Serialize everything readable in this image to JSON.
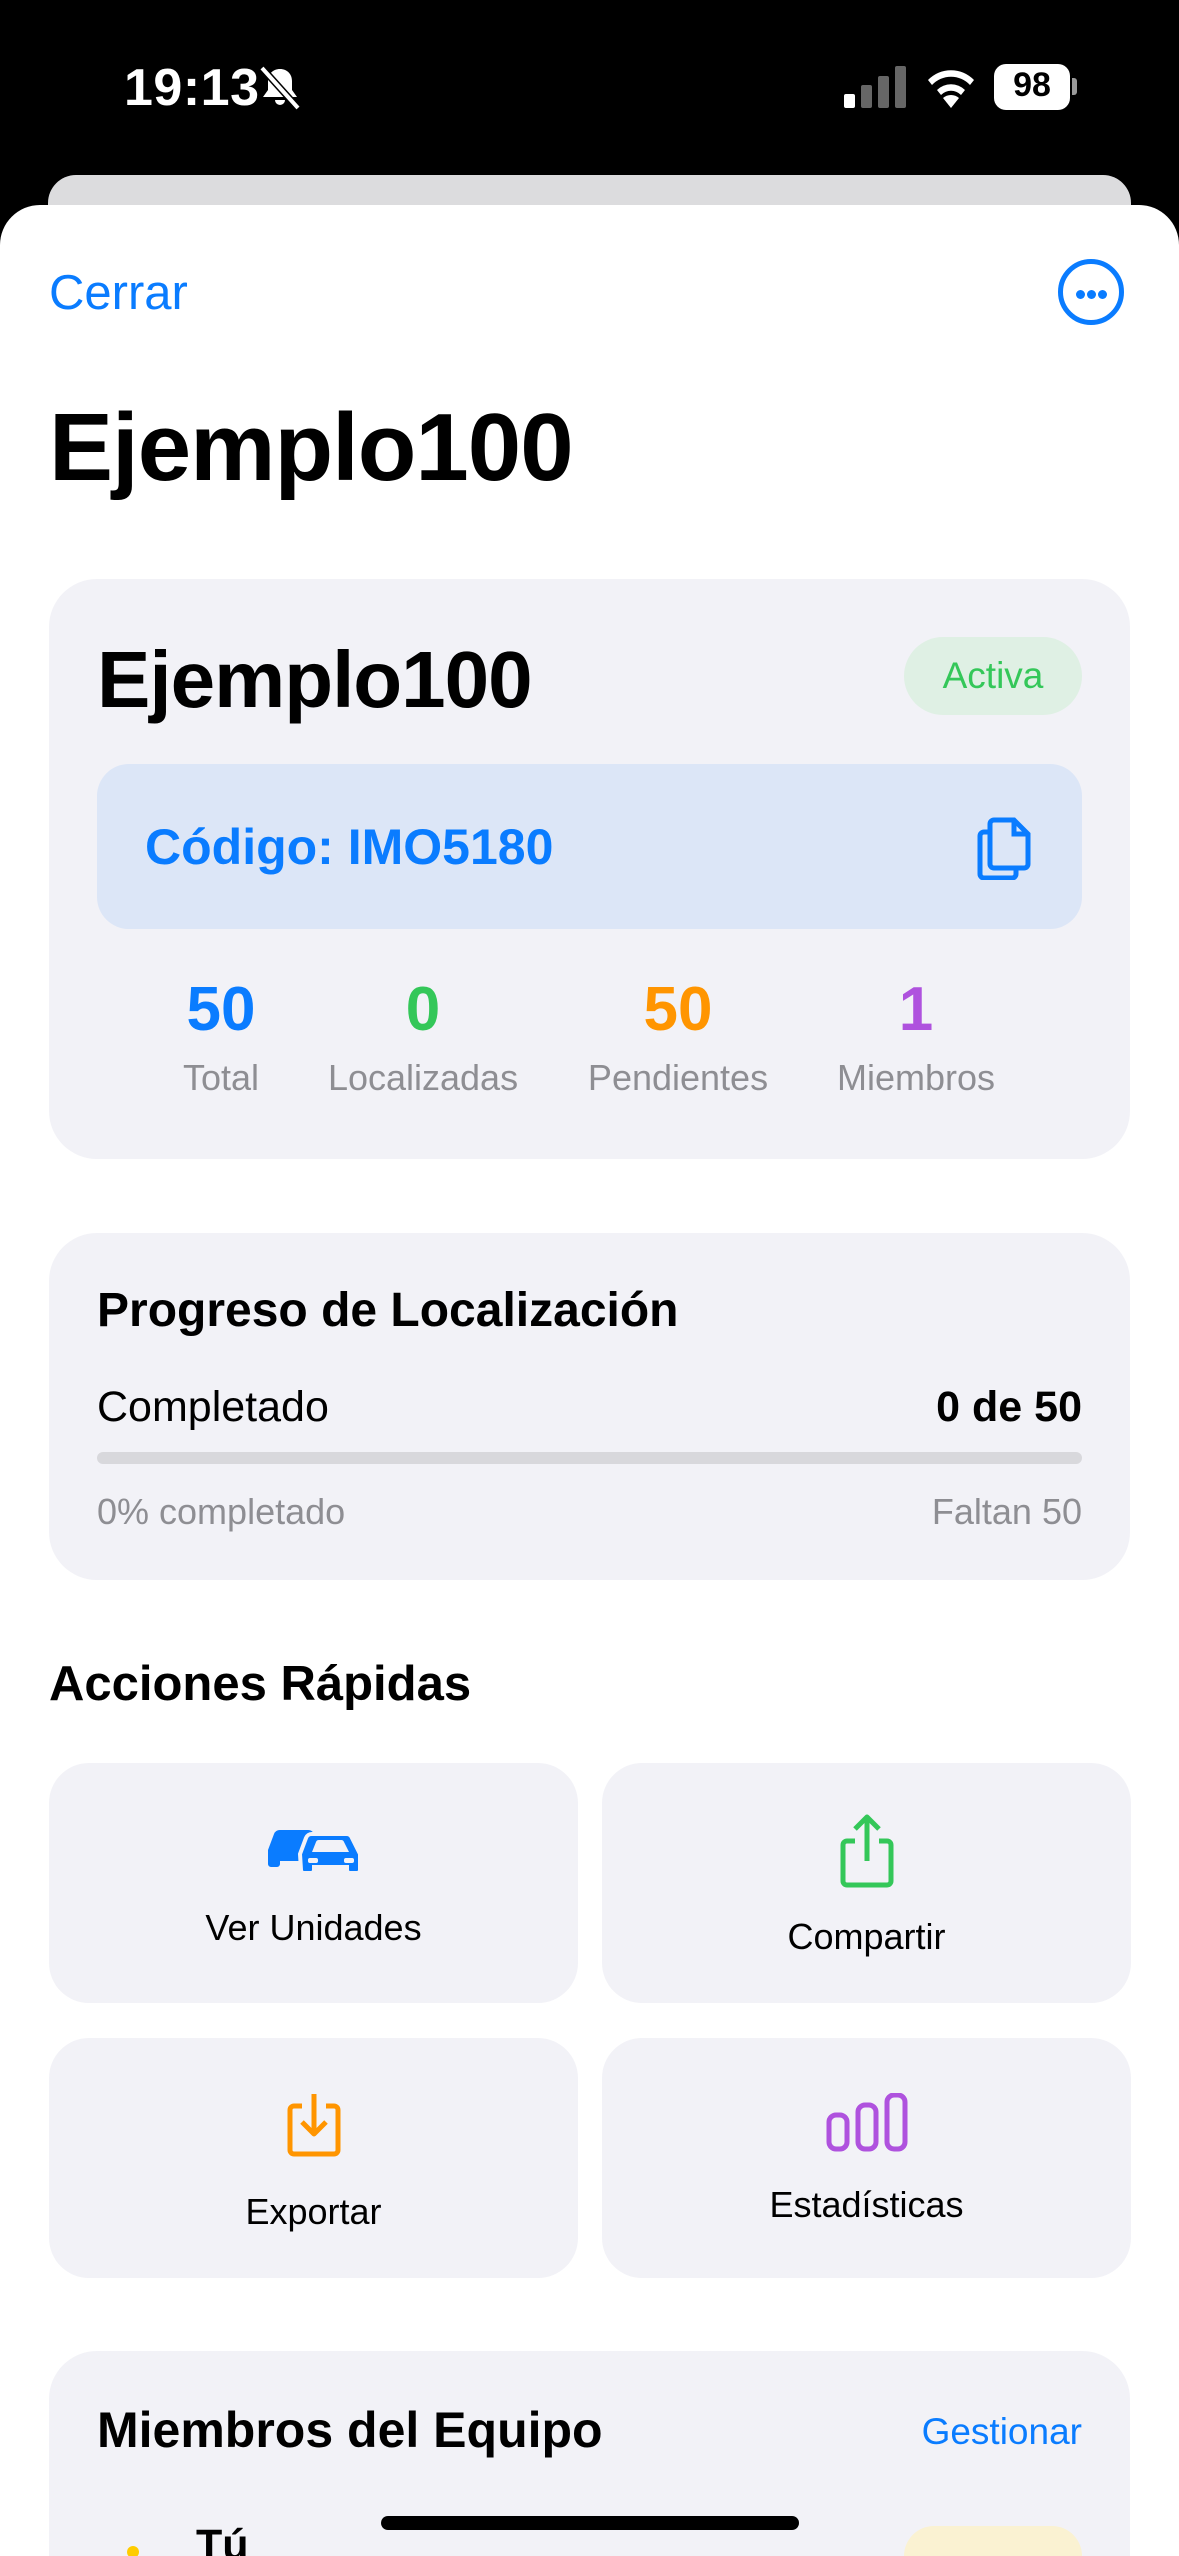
{
  "status_bar": {
    "time": "19:13",
    "battery": "98",
    "icons": [
      "bell-slash-icon",
      "cellular-signal-icon",
      "wifi-icon",
      "battery-icon"
    ]
  },
  "nav": {
    "close_label": "Cerrar",
    "more_icon": "ellipsis-circle-icon",
    "title": "Ejemplo100"
  },
  "summary": {
    "name": "Ejemplo100",
    "status": "Activa",
    "code_label": "Código: IMO5180",
    "copy_icon": "copy-icon",
    "stats": [
      {
        "value": "50",
        "label": "Total",
        "color": "#0a7cff"
      },
      {
        "value": "0",
        "label": "Localizadas",
        "color": "#34c759"
      },
      {
        "value": "50",
        "label": "Pendientes",
        "color": "#ff9500"
      },
      {
        "value": "1",
        "label": "Miembros",
        "color": "#af52de"
      }
    ]
  },
  "progress": {
    "title": "Progreso de Localización",
    "label": "Completado",
    "value": "0 de 50",
    "fraction": 0,
    "percent_text": "0% completado",
    "remaining_text": "Faltan 50"
  },
  "quick_actions": {
    "title": "Acciones Rápidas",
    "items": [
      {
        "label": "Ver Unidades",
        "icon": "cars-icon",
        "color": "#0a7cff"
      },
      {
        "label": "Compartir",
        "icon": "share-icon",
        "color": "#34c759"
      },
      {
        "label": "Exportar",
        "icon": "download-icon",
        "color": "#ff9500"
      },
      {
        "label": "Estadísticas",
        "icon": "chart-bars-icon",
        "color": "#af52de"
      }
    ]
  },
  "members": {
    "title": "Miembros del Equipo",
    "manage_label": "Gestionar",
    "items": [
      {
        "name": "Tú"
      }
    ]
  }
}
